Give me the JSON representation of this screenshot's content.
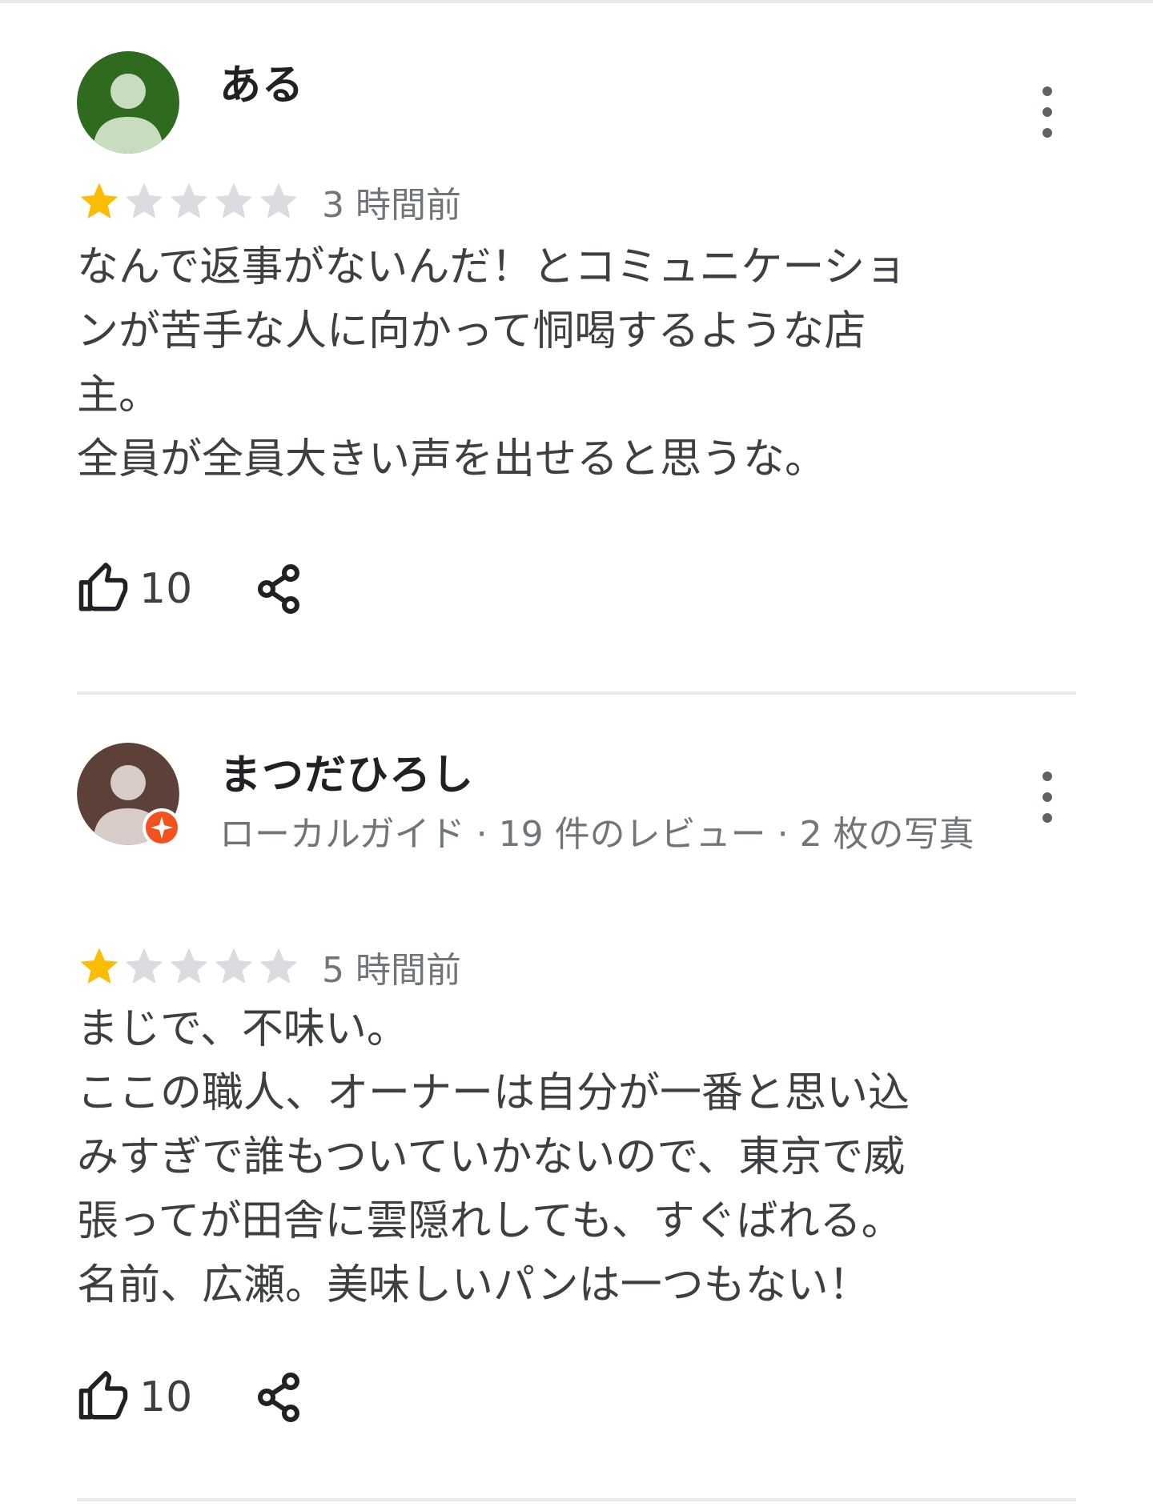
{
  "reviews": [
    {
      "author": "ある",
      "meta": "",
      "rating": 1,
      "max_rating": 5,
      "time": "3 時間前",
      "body_lines": [
        "なんで返事がないんだ！とコミュニケーショ",
        "ンが苦手な人に向かって恫喝するような店",
        "主。",
        "全員が全員大きい声を出せると思うな。"
      ],
      "likes": "10",
      "avatar_color": "#2e6b1f",
      "local_guide": false
    },
    {
      "author": "まつだひろし",
      "meta": "ローカルガイド · 19 件のレビュー · 2 枚の写真",
      "rating": 1,
      "max_rating": 5,
      "time": "5 時間前",
      "body_lines": [
        "まじで、不味い。",
        "ここの職人、オーナーは自分が一番と思い込",
        "みすぎで誰もついていかないので、東京で威",
        "張ってが田舎に雲隠れしても、すぐばれる。",
        "名前、広瀬。美味しいパンは一つもない！"
      ],
      "likes": "10",
      "avatar_color": "#5d4037",
      "local_guide": true
    }
  ],
  "icons": {
    "like": "thumb-up-icon",
    "share": "share-icon",
    "more": "more-vert-icon",
    "star_filled": "star-filled-icon",
    "star_empty": "star-empty-icon",
    "local_guide_badge": "local-guide-badge-icon"
  },
  "colors": {
    "star_filled": "#fbbc04",
    "star_empty": "#dadce0",
    "badge": "#f4511e",
    "text_secondary": "#70757a",
    "divider": "#e8eaed"
  }
}
